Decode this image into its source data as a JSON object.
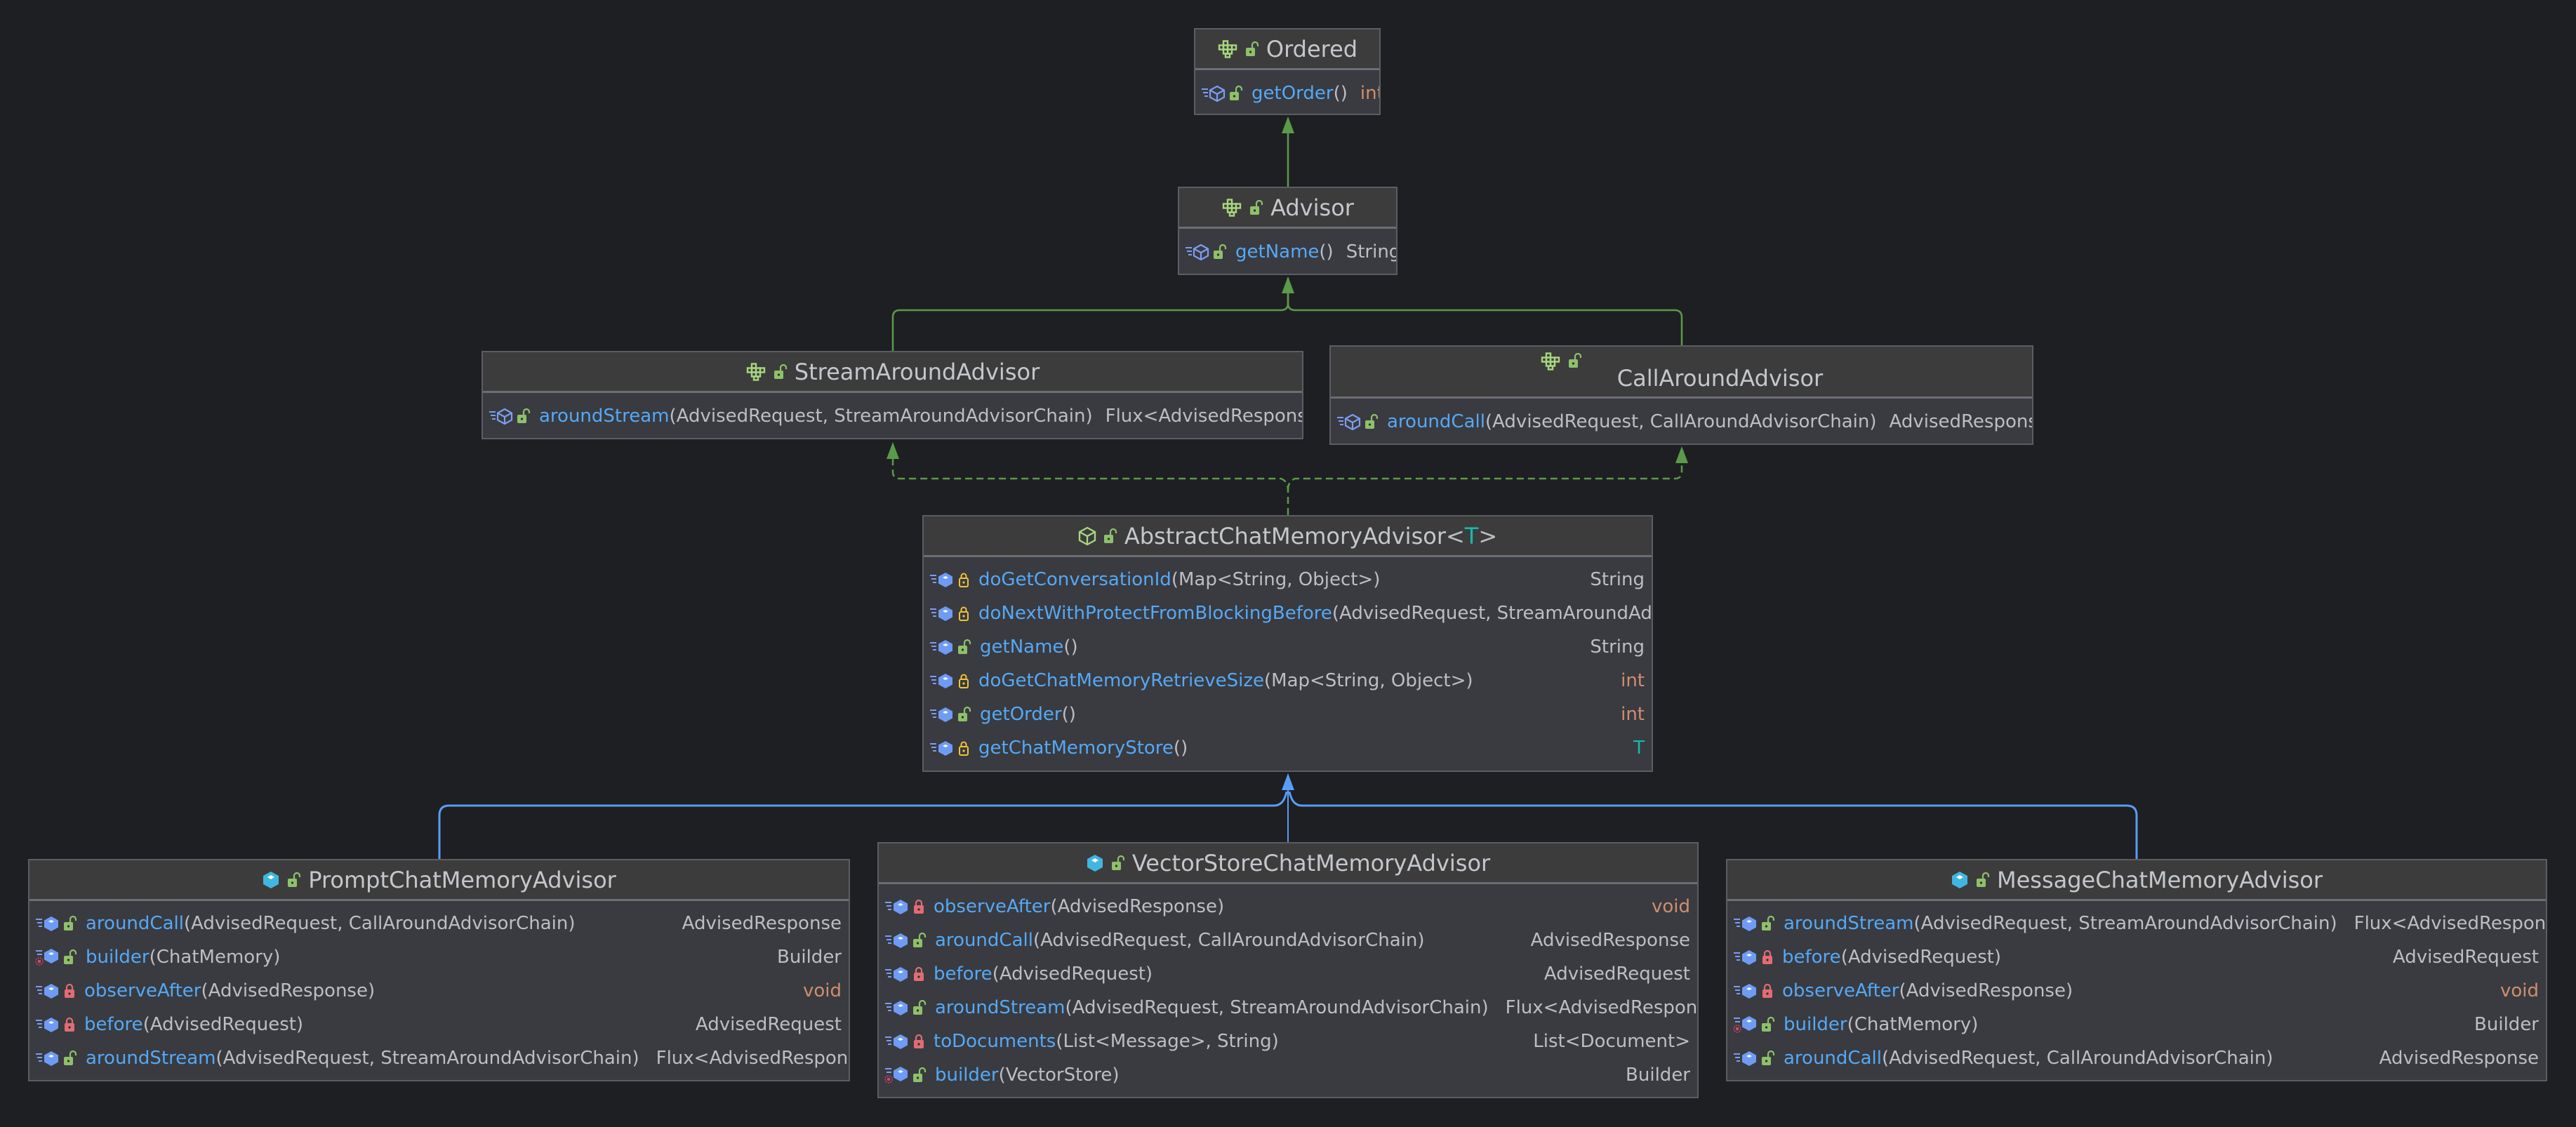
{
  "colors": {
    "background": "#1e1f22",
    "interface_edge": "#5b9a4a",
    "extends_edge": "#589df6",
    "method_name": "#56a8f5",
    "primitive_type": "#cf8e6d",
    "type_param": "#16baac"
  },
  "nodes": {
    "ordered": {
      "kind": "interface",
      "visibility": "public",
      "title": "Ordered",
      "methods": [
        {
          "name": "getOrder",
          "params": "()",
          "return": "int",
          "return_kind": "primitive",
          "visibility": "public",
          "method_icon": "abstract-method"
        }
      ]
    },
    "advisor": {
      "kind": "interface",
      "visibility": "public",
      "title": "Advisor",
      "methods": [
        {
          "name": "getName",
          "params": "()",
          "return": "String",
          "return_kind": "object",
          "visibility": "public",
          "method_icon": "abstract-method"
        }
      ]
    },
    "stream_around_advisor": {
      "kind": "interface",
      "visibility": "public",
      "title": "StreamAroundAdvisor",
      "methods": [
        {
          "name": "aroundStream",
          "params": "(AdvisedRequest, StreamAroundAdvisorChain)",
          "return": "Flux<AdvisedResponse>",
          "return_kind": "object",
          "visibility": "public",
          "method_icon": "abstract-method"
        }
      ]
    },
    "call_around_advisor": {
      "kind": "interface",
      "visibility": "public",
      "title": "CallAroundAdvisor",
      "methods": [
        {
          "name": "aroundCall",
          "params": "(AdvisedRequest, CallAroundAdvisorChain)",
          "return": "AdvisedResponse",
          "return_kind": "object",
          "visibility": "public",
          "method_icon": "abstract-method"
        }
      ]
    },
    "abstract_chat_memory_advisor": {
      "kind": "abstract-class",
      "visibility": "public",
      "title": "AbstractChatMemoryAdvisor",
      "title_generic_open": "<",
      "title_type_param": "T",
      "title_generic_close": ">",
      "methods": [
        {
          "name": "doGetConversationId",
          "params": "(Map<String, Object>)",
          "return": "String",
          "return_kind": "object",
          "visibility": "protected",
          "method_icon": "method"
        },
        {
          "name": "doNextWithProtectFromBlockingBefore",
          "params": "(AdvisedRequest, StreamAroundAdvis",
          "return": "",
          "return_kind": "object",
          "visibility": "protected",
          "method_icon": "method"
        },
        {
          "name": "getName",
          "params": "()",
          "return": "String",
          "return_kind": "object",
          "visibility": "public",
          "method_icon": "method"
        },
        {
          "name": "doGetChatMemoryRetrieveSize",
          "params": "(Map<String, Object>)",
          "return": "int",
          "return_kind": "primitive",
          "visibility": "protected",
          "method_icon": "method"
        },
        {
          "name": "getOrder",
          "params": "()",
          "return": "int",
          "return_kind": "primitive",
          "visibility": "public",
          "method_icon": "method"
        },
        {
          "name": "getChatMemoryStore",
          "params": "()",
          "return": "T",
          "return_kind": "typeparam",
          "visibility": "protected",
          "method_icon": "method"
        }
      ]
    },
    "prompt_chat_memory_advisor": {
      "kind": "class",
      "visibility": "public",
      "title": "PromptChatMemoryAdvisor",
      "methods": [
        {
          "name": "aroundCall",
          "params": "(AdvisedRequest, CallAroundAdvisorChain)",
          "return": "AdvisedResponse",
          "return_kind": "object",
          "visibility": "public",
          "method_icon": "method"
        },
        {
          "name": "builder",
          "params": "(ChatMemory)",
          "return": "Builder",
          "return_kind": "object",
          "visibility": "public",
          "method_icon": "static-method"
        },
        {
          "name": "observeAfter",
          "params": "(AdvisedResponse)",
          "return": "void",
          "return_kind": "primitive",
          "visibility": "private",
          "method_icon": "method"
        },
        {
          "name": "before",
          "params": "(AdvisedRequest)",
          "return": "AdvisedRequest",
          "return_kind": "object",
          "visibility": "private",
          "method_icon": "method"
        },
        {
          "name": "aroundStream",
          "params": "(AdvisedRequest, StreamAroundAdvisorChain)",
          "return": "Flux<AdvisedResponse>",
          "return_kind": "object",
          "visibility": "public",
          "method_icon": "method"
        }
      ]
    },
    "vector_store_chat_memory_advisor": {
      "kind": "class",
      "visibility": "public",
      "title": "VectorStoreChatMemoryAdvisor",
      "methods": [
        {
          "name": "observeAfter",
          "params": "(AdvisedResponse)",
          "return": "void",
          "return_kind": "primitive",
          "visibility": "private",
          "method_icon": "method"
        },
        {
          "name": "aroundCall",
          "params": "(AdvisedRequest, CallAroundAdvisorChain)",
          "return": "AdvisedResponse",
          "return_kind": "object",
          "visibility": "public",
          "method_icon": "method"
        },
        {
          "name": "before",
          "params": "(AdvisedRequest)",
          "return": "AdvisedRequest",
          "return_kind": "object",
          "visibility": "private",
          "method_icon": "method"
        },
        {
          "name": "aroundStream",
          "params": "(AdvisedRequest, StreamAroundAdvisorChain)",
          "return": "Flux<AdvisedResponse>",
          "return_kind": "object",
          "visibility": "public",
          "method_icon": "method"
        },
        {
          "name": "toDocuments",
          "params": "(List<Message>, String)",
          "return": "List<Document>",
          "return_kind": "object",
          "visibility": "private",
          "method_icon": "method"
        },
        {
          "name": "builder",
          "params": "(VectorStore)",
          "return": "Builder",
          "return_kind": "object",
          "visibility": "public",
          "method_icon": "static-method"
        }
      ]
    },
    "message_chat_memory_advisor": {
      "kind": "class",
      "visibility": "public",
      "title": "MessageChatMemoryAdvisor",
      "methods": [
        {
          "name": "aroundStream",
          "params": "(AdvisedRequest, StreamAroundAdvisorChain)",
          "return": "Flux<AdvisedResponse>",
          "return_kind": "object",
          "visibility": "public",
          "method_icon": "method"
        },
        {
          "name": "before",
          "params": "(AdvisedRequest)",
          "return": "AdvisedRequest",
          "return_kind": "object",
          "visibility": "private",
          "method_icon": "method"
        },
        {
          "name": "observeAfter",
          "params": "(AdvisedResponse)",
          "return": "void",
          "return_kind": "primitive",
          "visibility": "private",
          "method_icon": "method"
        },
        {
          "name": "builder",
          "params": "(ChatMemory)",
          "return": "Builder",
          "return_kind": "object",
          "visibility": "public",
          "method_icon": "static-method"
        },
        {
          "name": "aroundCall",
          "params": "(AdvisedRequest, CallAroundAdvisorChain)",
          "return": "AdvisedResponse",
          "return_kind": "object",
          "visibility": "public",
          "method_icon": "method"
        }
      ]
    }
  },
  "relations": [
    {
      "from": "advisor",
      "to": "ordered",
      "type": "interface-extends"
    },
    {
      "from": "stream_around_advisor",
      "to": "advisor",
      "type": "interface-extends"
    },
    {
      "from": "call_around_advisor",
      "to": "advisor",
      "type": "interface-extends"
    },
    {
      "from": "abstract_chat_memory_advisor",
      "to": "stream_around_advisor",
      "type": "implements"
    },
    {
      "from": "abstract_chat_memory_advisor",
      "to": "call_around_advisor",
      "type": "implements"
    },
    {
      "from": "prompt_chat_memory_advisor",
      "to": "abstract_chat_memory_advisor",
      "type": "extends"
    },
    {
      "from": "vector_store_chat_memory_advisor",
      "to": "abstract_chat_memory_advisor",
      "type": "extends"
    },
    {
      "from": "message_chat_memory_advisor",
      "to": "abstract_chat_memory_advisor",
      "type": "extends"
    }
  ]
}
